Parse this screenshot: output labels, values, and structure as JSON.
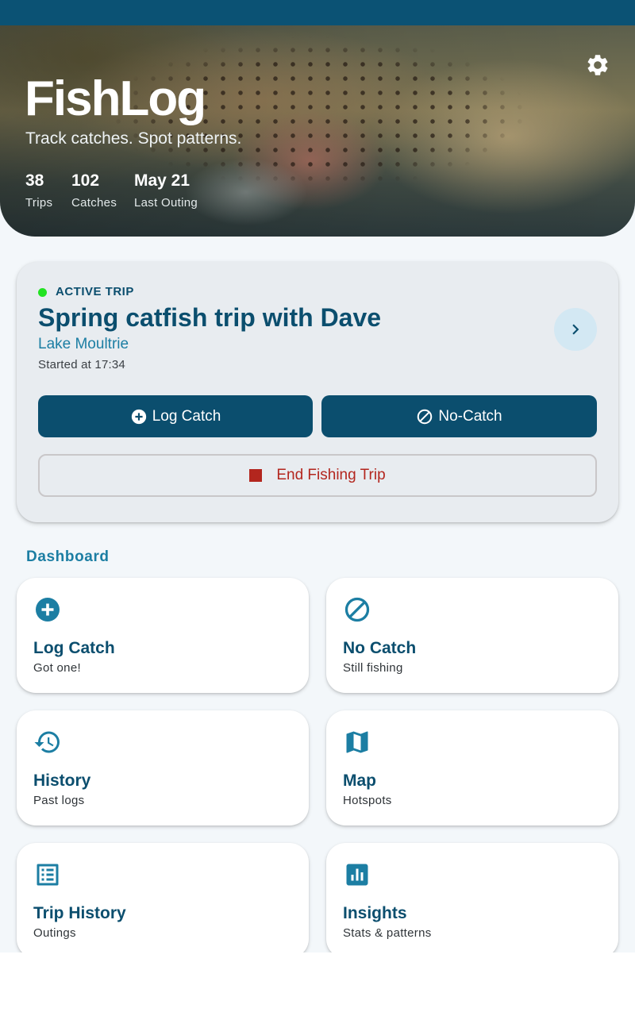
{
  "app": {
    "title": "FishLog",
    "subtitle": "Track catches. Spot patterns."
  },
  "stats": [
    {
      "value": "38",
      "label": "Trips"
    },
    {
      "value": "102",
      "label": "Catches"
    },
    {
      "value": "May 21",
      "label": "Last Outing"
    }
  ],
  "active_trip": {
    "status": "ACTIVE TRIP",
    "title": "Spring catfish trip with Dave",
    "location": "Lake Moultrie",
    "started": "Started at 17:34",
    "log_catch_label": "Log Catch",
    "no_catch_label": "No-Catch",
    "end_label": "End Fishing Trip"
  },
  "dashboard": {
    "title": "Dashboard",
    "tiles": [
      {
        "title": "Log Catch",
        "subtitle": "Got one!",
        "icon": "add-circle-icon"
      },
      {
        "title": "No Catch",
        "subtitle": "Still fishing",
        "icon": "block-icon"
      },
      {
        "title": "History",
        "subtitle": "Past logs",
        "icon": "history-icon"
      },
      {
        "title": "Map",
        "subtitle": "Hotspots",
        "icon": "map-icon"
      },
      {
        "title": "Trip History",
        "subtitle": "Outings",
        "icon": "list-icon"
      },
      {
        "title": "Insights",
        "subtitle": "Stats & patterns",
        "icon": "insights-icon"
      }
    ]
  },
  "colors": {
    "primary": "#0b4e6e",
    "accent": "#1c7ea3",
    "danger": "#b3261e",
    "active_indicator": "#22e322",
    "background": "#f3f7fa"
  }
}
